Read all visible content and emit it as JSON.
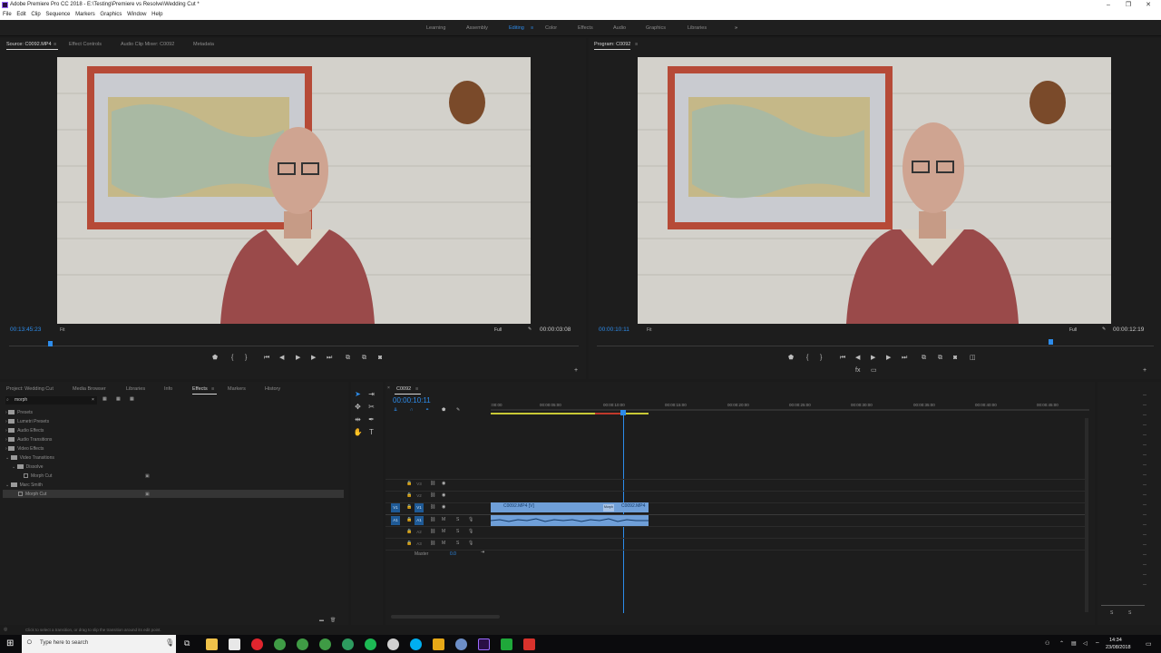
{
  "window": {
    "title": "Adobe Premiere Pro CC 2018 - E:\\Testing\\Premiere vs Resolve\\Wedding Cut *"
  },
  "menu": [
    "File",
    "Edit",
    "Clip",
    "Sequence",
    "Markers",
    "Graphics",
    "Window",
    "Help"
  ],
  "workspaces": {
    "items": [
      "Learning",
      "Assembly",
      "Editing",
      "Color",
      "Effects",
      "Audio",
      "Graphics",
      "Libraries"
    ],
    "active": "Editing",
    "overflow": "»"
  },
  "source_panel": {
    "tabs": [
      "Source: C0092.MP4",
      "Effect Controls",
      "Audio Clip Mixer: C0092",
      "Metadata"
    ],
    "timecode": "00:13:45:23",
    "fit": "Fit",
    "quality": "Full",
    "duration": "00:00:03:08"
  },
  "program_panel": {
    "tab": "Program: C0092",
    "timecode": "00:00:10:11",
    "fit": "Fit",
    "quality": "Full",
    "duration": "00:00:12:19"
  },
  "project_panel": {
    "tabs": [
      "Project: Wedding Cut",
      "Media Browser",
      "Libraries",
      "Info",
      "Effects",
      "Markers",
      "History"
    ],
    "active_tab": "Effects",
    "search_value": "morph",
    "tree": [
      {
        "label": "Presets",
        "type": "folder",
        "indent": 0
      },
      {
        "label": "Lumetri Presets",
        "type": "folder",
        "indent": 0
      },
      {
        "label": "Audio Effects",
        "type": "folder",
        "indent": 0
      },
      {
        "label": "Audio Transitions",
        "type": "folder",
        "indent": 0
      },
      {
        "label": "Video Effects",
        "type": "folder",
        "indent": 0
      },
      {
        "label": "Video Transitions",
        "type": "folder",
        "indent": 0
      },
      {
        "label": "Dissolve",
        "type": "folder",
        "indent": 1
      },
      {
        "label": "Morph Cut",
        "type": "effect",
        "indent": 2
      },
      {
        "label": "Marc Smith",
        "type": "folder",
        "indent": 0
      },
      {
        "label": "Morph Cut",
        "type": "effect",
        "indent": 1
      }
    ]
  },
  "timeline": {
    "tab": "C0092",
    "timecode": "00:00:10:11",
    "ruler": [
      ":00:00",
      "00:00:05:00",
      "00:00:10:00",
      "00:00:15:00",
      "00:00:20:00",
      "00:00:25:00",
      "00:00:30:00",
      "00:00:35:00",
      "00:00:40:00",
      "00:00:45:00"
    ],
    "tracks": [
      {
        "id": "V3",
        "kind": "video",
        "targeted": false
      },
      {
        "id": "V2",
        "kind": "video",
        "targeted": false
      },
      {
        "id": "V1",
        "kind": "video",
        "targeted": true
      },
      {
        "id": "A1",
        "kind": "audio",
        "targeted": true
      },
      {
        "id": "A2",
        "kind": "audio",
        "targeted": false
      },
      {
        "id": "A3",
        "kind": "audio",
        "targeted": false
      }
    ],
    "source_patch": {
      "video": "V1",
      "audio": "A1"
    },
    "master_label": "Master",
    "master_value": "0.0",
    "clip_a_label": "C0092.MP4 [V]",
    "clip_b_label": "C0092.MP4",
    "transition_label": "Morph"
  },
  "status_bar": {
    "text": "Click to select a transition, or drag to slip the transition around its edit point."
  },
  "taskbar": {
    "search_placeholder": "Type here to search",
    "time": "14:34",
    "date": "23/08/2018"
  },
  "colors": {
    "accent": "#2d8ceb",
    "clip": "#6f9fd8",
    "track_target": "#1f5a96",
    "work_area": "#c9c936"
  },
  "icons": [
    "windows-icon",
    "search-icon",
    "microphone-icon",
    "task-view-icon",
    "folder-icon",
    "store-icon",
    "opera-icon",
    "chrome-icon",
    "premiere-icon",
    "play-icon",
    "marker-icon",
    "wrench-icon",
    "lock-icon",
    "eye-icon",
    "mic-icon"
  ]
}
